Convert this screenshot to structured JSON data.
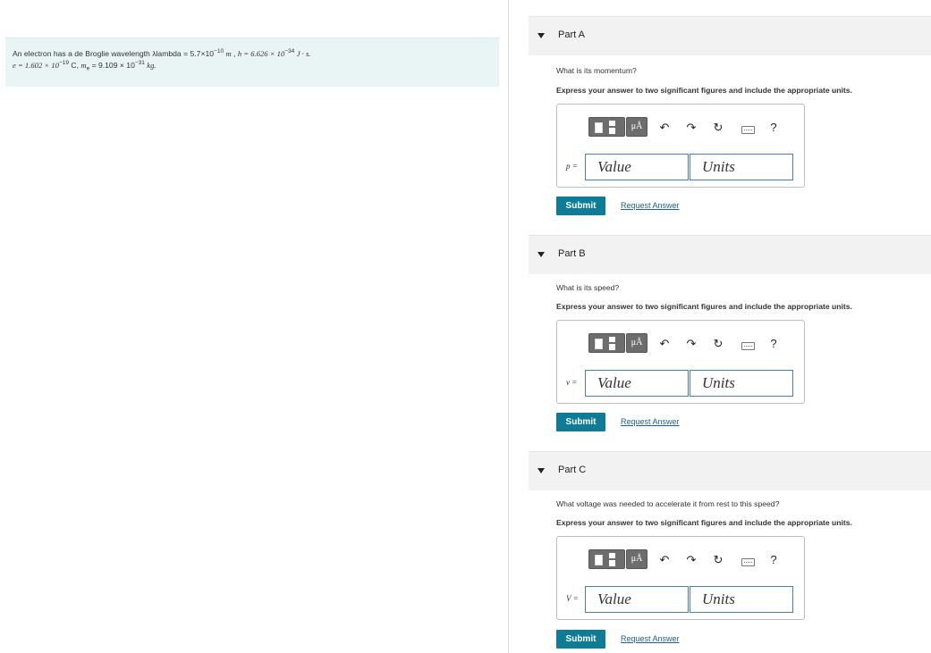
{
  "problem": {
    "intro": "An electron has a de Broglie wavelength λlambda = 5.7×10",
    "lambda_exp": "−10",
    "lambda_unit": "m",
    "h_text": "h = 6.626 × 10",
    "h_exp": "−34",
    "h_unit": "J · s.",
    "e_text": "e = 1.602 × 10",
    "e_exp": "−19",
    "e_unit": "C,",
    "m_text": "m",
    "m_sub": "e",
    "m_val": "= 9.109 × 10",
    "m_exp": "−31",
    "m_unit": "kg."
  },
  "toolbar": {
    "unit_button": "μÅ",
    "undo_icon": "undo-arrow",
    "redo_icon": "redo-arrow",
    "reset_icon": "reset-circle",
    "keyboard_icon": "keyboard",
    "help_label": "?"
  },
  "parts": [
    {
      "title": "Part A",
      "question": "What is its momentum?",
      "instruction": "Express your answer to two significant figures and include the appropriate units.",
      "var": "p =",
      "value_placeholder": "Value",
      "units_placeholder": "Units",
      "submit": "Submit",
      "request": "Request Answer"
    },
    {
      "title": "Part B",
      "question": "What is its speed?",
      "instruction": "Express your answer to two significant figures and include the appropriate units.",
      "var": "v =",
      "value_placeholder": "Value",
      "units_placeholder": "Units",
      "submit": "Submit",
      "request": "Request Answer"
    },
    {
      "title": "Part C",
      "question": "What voltage was needed to accelerate it from rest to this speed?",
      "instruction": "Express your answer to two significant figures and include the appropriate units.",
      "var": "V =",
      "value_placeholder": "Value",
      "units_placeholder": "Units",
      "submit": "Submit",
      "request": "Request Answer"
    }
  ],
  "colors": {
    "submit_bg": "#0e7c96",
    "link": "#1f5f93",
    "problem_bg": "#e9f4f5",
    "field_border": "#4a7fb0"
  }
}
